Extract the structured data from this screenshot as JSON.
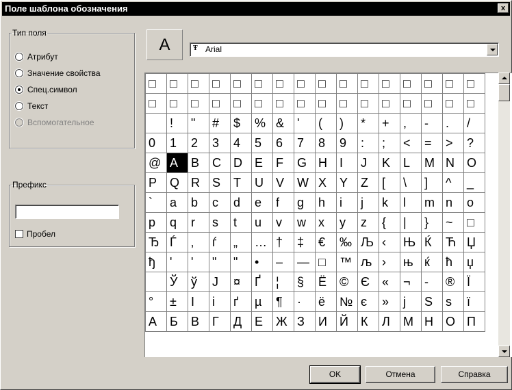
{
  "window": {
    "title": "Поле шаблона обозначения",
    "close_label": "x"
  },
  "field_type": {
    "legend": "Тип поля",
    "options": [
      {
        "label": "Атрибут",
        "checked": false,
        "disabled": false
      },
      {
        "label": "Значение свойства",
        "checked": false,
        "disabled": false
      },
      {
        "label": "Спец.символ",
        "checked": true,
        "disabled": false
      },
      {
        "label": "Текст",
        "checked": false,
        "disabled": false
      },
      {
        "label": "Вспомогательное",
        "checked": false,
        "disabled": true
      }
    ]
  },
  "prefix": {
    "legend": "Префикс",
    "value": "",
    "space_label": "Пробел",
    "space_checked": false
  },
  "preview": {
    "char": "A"
  },
  "font": {
    "icon": "truetype-icon",
    "value": "Arial"
  },
  "char_grid": {
    "selected": [
      4,
      1
    ],
    "rows": [
      [
        "□",
        "□",
        "□",
        "□",
        "□",
        "□",
        "□",
        "□",
        "□",
        "□",
        "□",
        "□",
        "□",
        "□",
        "□",
        "□"
      ],
      [
        "□",
        "□",
        "□",
        "□",
        "□",
        "□",
        "□",
        "□",
        "□",
        "□",
        "□",
        "□",
        "□",
        "□",
        "□",
        "□"
      ],
      [
        " ",
        "!",
        "\"",
        "#",
        "$",
        "%",
        "&",
        "'",
        "(",
        ")",
        "*",
        "+",
        ",",
        "-",
        ".",
        "/"
      ],
      [
        "0",
        "1",
        "2",
        "3",
        "4",
        "5",
        "6",
        "7",
        "8",
        "9",
        ":",
        ";",
        "<",
        "=",
        ">",
        "?"
      ],
      [
        "@",
        "A",
        "B",
        "C",
        "D",
        "E",
        "F",
        "G",
        "H",
        "I",
        "J",
        "K",
        "L",
        "M",
        "N",
        "O"
      ],
      [
        "P",
        "Q",
        "R",
        "S",
        "T",
        "U",
        "V",
        "W",
        "X",
        "Y",
        "Z",
        "[",
        "\\",
        "]",
        "^",
        "_"
      ],
      [
        "`",
        "a",
        "b",
        "c",
        "d",
        "e",
        "f",
        "g",
        "h",
        "i",
        "j",
        "k",
        "l",
        "m",
        "n",
        "o"
      ],
      [
        "p",
        "q",
        "r",
        "s",
        "t",
        "u",
        "v",
        "w",
        "x",
        "y",
        "z",
        "{",
        "|",
        "}",
        "~",
        "□"
      ],
      [
        "Ђ",
        "Ѓ",
        "‚",
        "ѓ",
        "„",
        "…",
        "†",
        "‡",
        "€",
        "‰",
        "Љ",
        "‹",
        "Њ",
        "Ќ",
        "Ћ",
        "Џ"
      ],
      [
        "ђ",
        "'",
        "'",
        "\"",
        "\"",
        "•",
        "–",
        "—",
        "□",
        "™",
        "љ",
        "›",
        "њ",
        "ќ",
        "ћ",
        "џ"
      ],
      [
        " ",
        "Ў",
        "ў",
        "Ј",
        "¤",
        "Ґ",
        "¦",
        "§",
        "Ё",
        "©",
        "Є",
        "«",
        "¬",
        "-",
        "®",
        "Ї"
      ],
      [
        "°",
        "±",
        "І",
        "і",
        "ґ",
        "µ",
        "¶",
        "·",
        "ё",
        "№",
        "є",
        "»",
        "ј",
        "Ѕ",
        "ѕ",
        "ї"
      ],
      [
        "А",
        "Б",
        "В",
        "Г",
        "Д",
        "Е",
        "Ж",
        "З",
        "И",
        "Й",
        "К",
        "Л",
        "М",
        "Н",
        "О",
        "П"
      ]
    ]
  },
  "buttons": {
    "ok": "OK",
    "cancel": "Отмена",
    "help": "Справка"
  }
}
